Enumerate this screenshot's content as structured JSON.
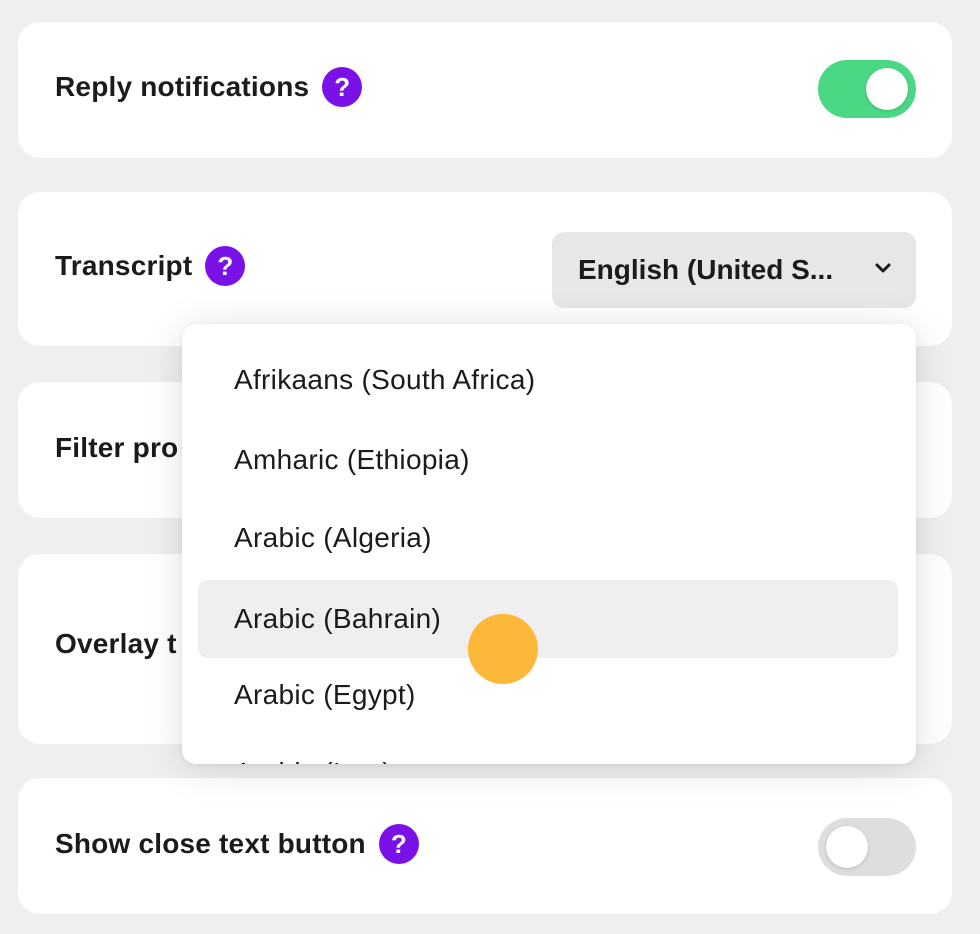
{
  "settings": {
    "reply_notifications": {
      "label": "Reply notifications",
      "help": "?",
      "enabled": true
    },
    "transcript": {
      "label": "Transcript",
      "help": "?",
      "selected": "English (United S...",
      "chevron_icon": "chevron-down-icon"
    },
    "filter_profanity": {
      "label": "Filter pro"
    },
    "overlay_text": {
      "label": "Overlay t"
    },
    "show_close_text_button": {
      "label": "Show close text button",
      "help": "?",
      "enabled": false
    }
  },
  "dropdown": {
    "options": [
      {
        "label": "Afrikaans (South Africa)"
      },
      {
        "label": "Amharic (Ethiopia)"
      },
      {
        "label": "Arabic (Algeria)"
      },
      {
        "label": "Arabic (Bahrain)",
        "hovered": true
      },
      {
        "label": "Arabic (Egypt)"
      },
      {
        "label": "Arabic (Iraq)"
      }
    ]
  },
  "colors": {
    "accent_purple": "#7a12e8",
    "toggle_on": "#4bd885",
    "toggle_off": "#dedede",
    "cursor": "#fdb83a"
  }
}
